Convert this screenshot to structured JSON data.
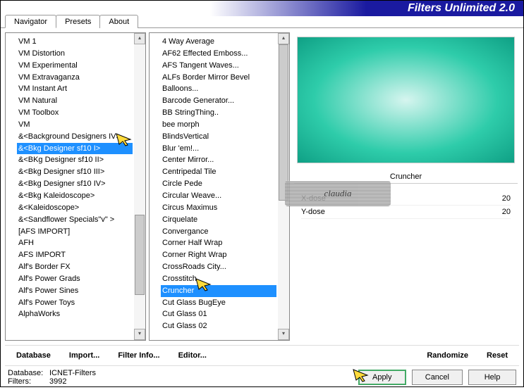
{
  "title": "Filters Unlimited 2.0",
  "tabs": [
    "Navigator",
    "Presets",
    "About"
  ],
  "activeTab": 0,
  "leftList": [
    "VM 1",
    "VM Distortion",
    "VM Experimental",
    "VM Extravaganza",
    "VM Instant Art",
    "VM Natural",
    "VM Toolbox",
    "VM",
    "&<Background Designers IV>",
    "&<Bkg Designer sf10 I>",
    "&<BKg Designer sf10 II>",
    "&<Bkg Designer sf10 III>",
    "&<Bkg Designer sf10 IV>",
    "&<Bkg Kaleidoscope>",
    "&<Kaleidoscope>",
    "&<Sandflower Specials\"v\" >",
    "[AFS IMPORT]",
    "AFH",
    "AFS IMPORT",
    "Alf's Border FX",
    "Alf's Power Grads",
    "Alf's Power Sines",
    "Alf's Power Toys",
    "AlphaWorks"
  ],
  "leftSelectedIndex": 9,
  "midList": [
    "4 Way Average",
    "AF62 Effected Emboss...",
    "AFS Tangent Waves...",
    "ALFs Border Mirror Bevel",
    "Balloons...",
    "Barcode Generator...",
    "BB StringThing..",
    "bee morph",
    "BlindsVertical",
    "Blur 'em!...",
    "Center Mirror...",
    "Centripedal Tile",
    "Circle Pede",
    "Circular Weave...",
    "Circus Maximus",
    "Cirquelate",
    "Convergance",
    "Corner Half Wrap",
    "Corner Right Wrap",
    "CrossRoads City...",
    "Crosstitch",
    "Cruncher",
    "Cut Glass  BugEye",
    "Cut Glass 01",
    "Cut Glass 02"
  ],
  "midSelectedIndex": 21,
  "selectedFilterName": "Cruncher",
  "params": [
    {
      "name": "X-dose",
      "value": "20"
    },
    {
      "name": "Y-dose",
      "value": "20"
    }
  ],
  "bottomButtons": {
    "left": [
      "Database",
      "Import...",
      "Filter Info...",
      "Editor..."
    ],
    "right": [
      "Randomize",
      "Reset"
    ]
  },
  "status": {
    "databaseLabel": "Database:",
    "database": "ICNET-Filters",
    "filtersLabel": "Filters:",
    "filters": "3992"
  },
  "dlgButtons": {
    "apply": "Apply",
    "cancel": "Cancel",
    "help": "Help"
  },
  "watermark": "claudia"
}
